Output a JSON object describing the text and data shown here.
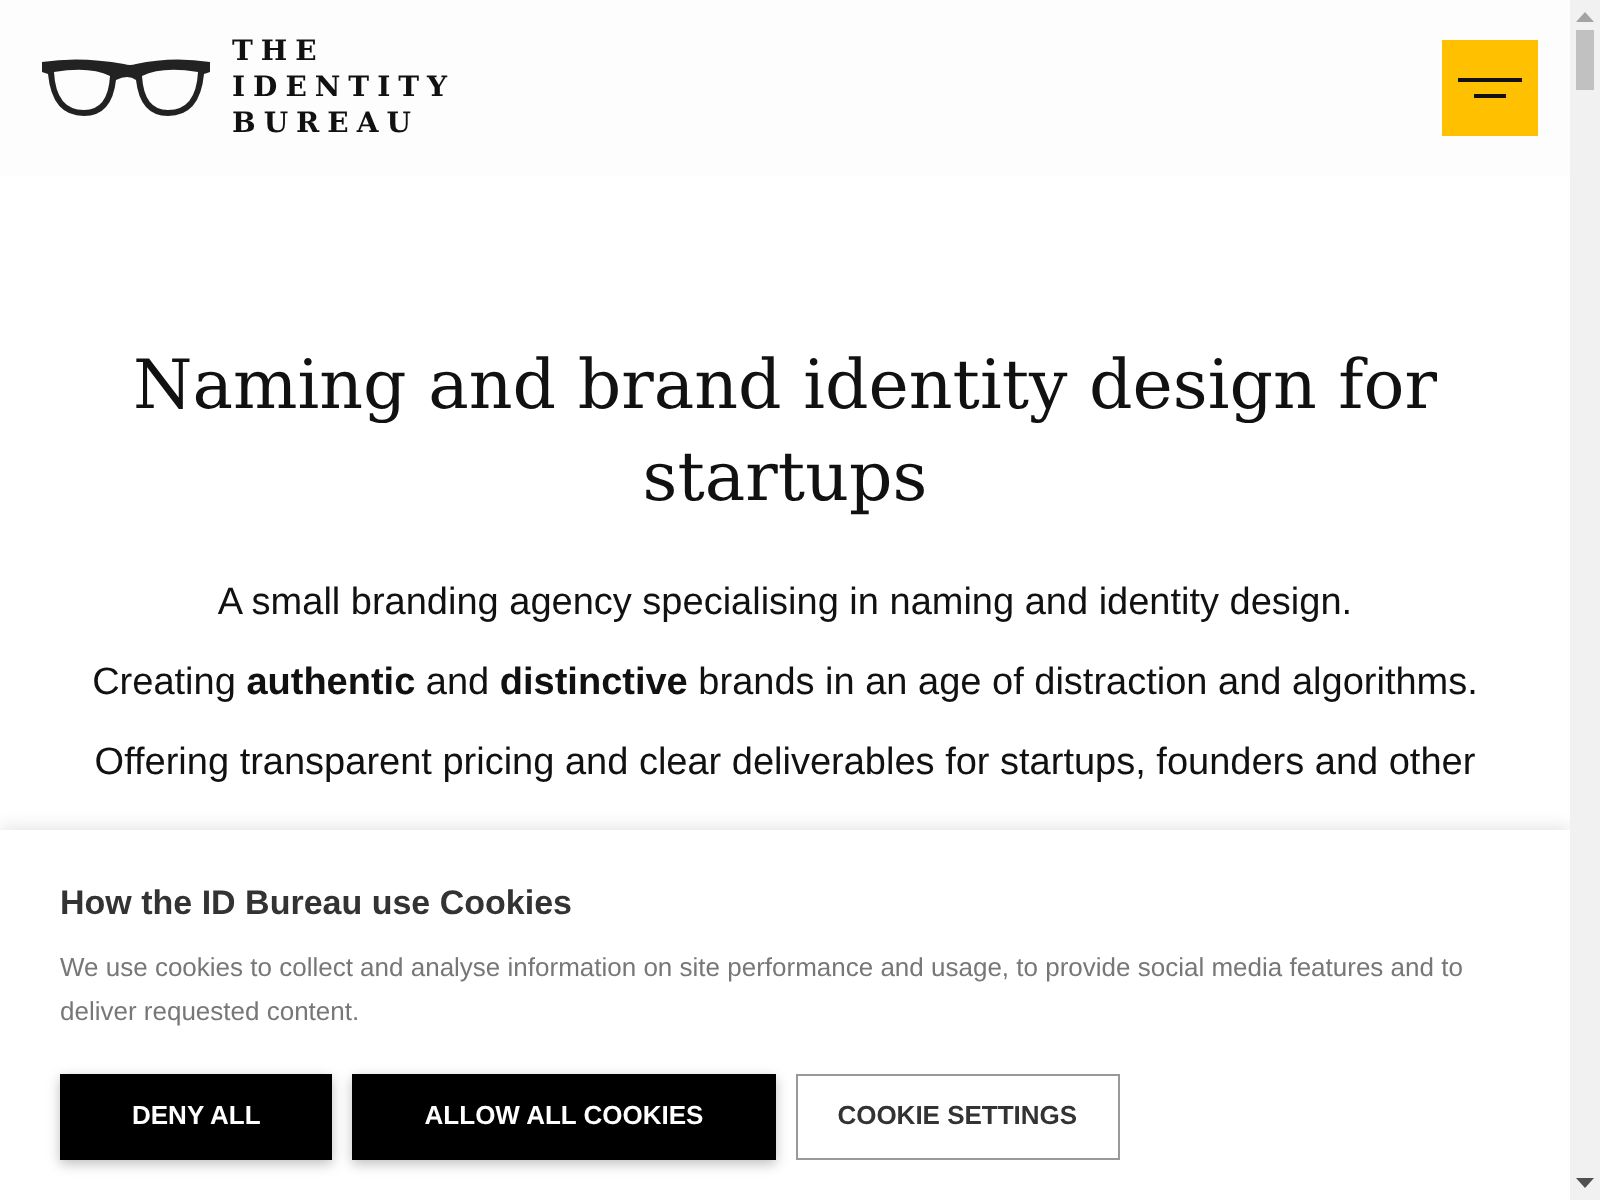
{
  "header": {
    "logo_lines": [
      "THE",
      "IDENTITY",
      "BUREAU"
    ]
  },
  "hero": {
    "title": "Naming and brand identity design for startups",
    "paragraphs": [
      "A small branding agency specialising in naming and identity design.",
      "Creating **authentic** and **distinctive** brands in an age of distraction and algorithms.",
      "Offering transparent pricing and clear deliverables for startups, founders and other"
    ]
  },
  "cookie_banner": {
    "title": "How the ID Bureau use Cookies",
    "text": " We use cookies to collect and analyse information on site performance and usage, to provide social media features and to deliver requested content.",
    "buttons": [
      {
        "label": "DENY ALL",
        "kind": "filled"
      },
      {
        "label": "ALLOW ALL COOKIES",
        "kind": "filled"
      },
      {
        "label": "COOKIE SETTINGS",
        "kind": "outline"
      }
    ]
  }
}
